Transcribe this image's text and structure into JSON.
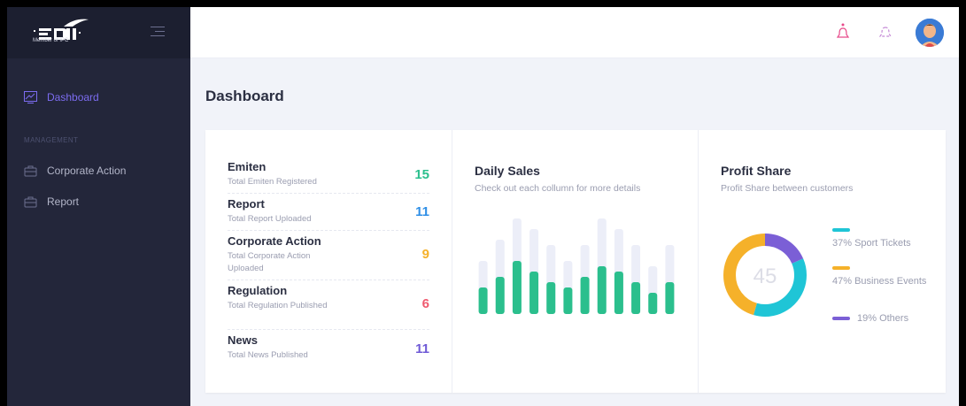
{
  "sidebar": {
    "logo_caption": "Member of IPC",
    "items": [
      {
        "label": "Dashboard",
        "icon": "chart-line-icon",
        "active": true
      },
      {
        "label": "Corporate Action",
        "icon": "briefcase-icon",
        "active": false
      },
      {
        "label": "Report",
        "icon": "briefcase-icon",
        "active": false
      }
    ],
    "section_label": "Management"
  },
  "topbar": {
    "icons": [
      "notification-bell-icon",
      "notification-bell-icon",
      "avatar"
    ]
  },
  "page": {
    "title": "Dashboard"
  },
  "stats": [
    {
      "title": "Emiten",
      "subtitle": "Total Emiten Registered",
      "value": "15",
      "color": "#2bbf8d"
    },
    {
      "title": "Report",
      "subtitle": "Total Report Uploaded",
      "value": "11",
      "color": "#2f8fe6"
    },
    {
      "title": "Corporate Action",
      "subtitle": "Total Corporate Action Uploaded",
      "value": "9",
      "color": "#f5b12a"
    },
    {
      "title": "Regulation",
      "subtitle": "Total Regulation Published",
      "value": "6",
      "color": "#ef5a6f"
    },
    {
      "title": "News",
      "subtitle": "Total News Published",
      "value": "11",
      "color": "#6f5ad6"
    }
  ],
  "daily_sales": {
    "title": "Daily Sales",
    "subtitle": "Check out each collumn for more details"
  },
  "profit_share": {
    "title": "Profit Share",
    "subtitle": "Profit Share between customers",
    "center_value": "45",
    "legend": [
      {
        "label": "37% Sport Tickets",
        "color": "#1fc5d6"
      },
      {
        "label": "47% Business Events",
        "color": "#f5b12a"
      },
      {
        "label": "19% Others",
        "color": "#7b5fd6"
      }
    ]
  },
  "chart_data": [
    {
      "type": "bar",
      "title": "Daily Sales",
      "series": [
        {
          "values": [
            5,
            7,
            10,
            8,
            6,
            5,
            7,
            9,
            8,
            6,
            4,
            6
          ]
        },
        {
          "values": [
            10,
            14,
            18,
            16,
            13,
            10,
            13,
            18,
            16,
            13,
            9,
            13
          ]
        }
      ],
      "colors": [
        "#2bbf8d",
        "#eceef8"
      ]
    },
    {
      "type": "pie",
      "title": "Profit Share",
      "values": [
        37,
        47,
        19
      ],
      "labels": [
        "Sport Tickets",
        "Business Events",
        "Others"
      ],
      "colors": [
        "#1fc5d6",
        "#f5b12a",
        "#7b5fd6"
      ]
    }
  ]
}
